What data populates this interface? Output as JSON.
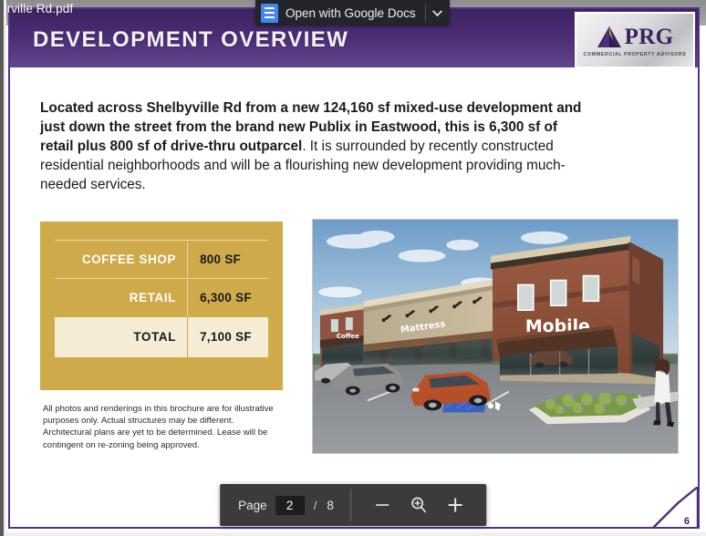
{
  "viewer": {
    "filename": "erville Rd.pdf",
    "open_with": {
      "label": "Open with Google Docs",
      "icon": "google-docs-icon",
      "caret_icon": "chevron-down-icon"
    },
    "toolbar": {
      "page_label": "Page",
      "page_value": "2",
      "separator": "/",
      "page_total": "8",
      "zoom_out_icon": "minus-icon",
      "zoom_icon": "magnifier-icon",
      "zoom_in_icon": "plus-icon"
    }
  },
  "slide": {
    "title": "DEVELOPMENT OVERVIEW",
    "accent_purple": "#4a2c73",
    "accent_gold": "#ceaa4b",
    "logo": {
      "name": "PRG",
      "tagline": "COMMERCIAL PROPERTY ADVISORS",
      "mark_icon": "prg-triangle-mark"
    },
    "paragraph": {
      "bold": "Located across Shelbyville Rd from a new 124,160 sf mixed-use development and just down the street from the brand new Publix in Eastwood, this is 6,300 sf of retail plus 800 sf of drive-thru outparcel",
      "rest": ". It is surrounded by recently constructed residential neighborhoods and will be a flourishing new development providing much-needed services."
    },
    "sf_table": {
      "rows": [
        {
          "label": "COFFEE SHOP",
          "value": "800 SF"
        },
        {
          "label": "RETAIL",
          "value": "6,300 SF"
        },
        {
          "label": "TOTAL",
          "value": "7,100 SF"
        }
      ]
    },
    "disclaimer": "All photos and renderings in this brochure are for illustrative purposes only. Actual structures may be different. Architectural plans are yet to be determined. Lease will be contingent on re-zoning being approved.",
    "rendering": {
      "alt": "architectural rendering of retail strip center",
      "signs": [
        "Coffee",
        "Mattress",
        "Mobile"
      ]
    },
    "page_number": "6"
  }
}
